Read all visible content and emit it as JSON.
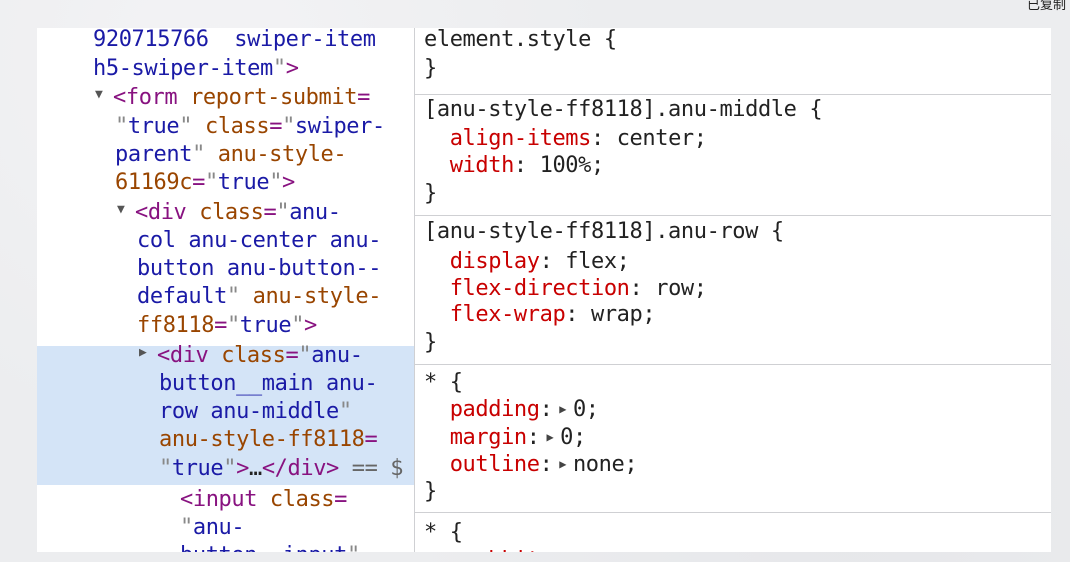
{
  "elements": {
    "lines": [
      {
        "parts": [
          {
            "c": "val",
            "t": "920715766  swiper-item"
          }
        ]
      },
      {
        "parts": [
          {
            "c": "val",
            "t": "h5-swiper-item"
          },
          {
            "c": "qt",
            "t": "\""
          },
          {
            "c": "tag",
            "t": ">"
          }
        ]
      },
      {
        "tri": "▼",
        "parts": [
          {
            "c": "tag",
            "t": "<form "
          },
          {
            "c": "attr",
            "t": "report-submit"
          },
          {
            "c": "tag",
            "t": "="
          }
        ]
      },
      {
        "parts": [
          {
            "c": "qt",
            "t": "\""
          },
          {
            "c": "val",
            "t": "true"
          },
          {
            "c": "qt",
            "t": "\""
          },
          {
            "c": "txt",
            "t": " "
          },
          {
            "c": "attr",
            "t": "class"
          },
          {
            "c": "tag",
            "t": "="
          },
          {
            "c": "qt",
            "t": "\""
          },
          {
            "c": "val",
            "t": "swiper-"
          }
        ]
      },
      {
        "parts": [
          {
            "c": "val",
            "t": "parent"
          },
          {
            "c": "qt",
            "t": "\""
          },
          {
            "c": "txt",
            "t": " "
          },
          {
            "c": "attr",
            "t": "anu-style-"
          }
        ]
      },
      {
        "parts": [
          {
            "c": "attr",
            "t": "61169c"
          },
          {
            "c": "tag",
            "t": "="
          },
          {
            "c": "qt",
            "t": "\""
          },
          {
            "c": "val",
            "t": "true"
          },
          {
            "c": "qt",
            "t": "\""
          },
          {
            "c": "tag",
            "t": ">"
          }
        ]
      },
      {
        "tri": "▼",
        "parts": [
          {
            "c": "tag",
            "t": "<div "
          },
          {
            "c": "attr",
            "t": "class"
          },
          {
            "c": "tag",
            "t": "="
          },
          {
            "c": "qt",
            "t": "\""
          },
          {
            "c": "val",
            "t": "anu-"
          }
        ]
      },
      {
        "parts": [
          {
            "c": "val",
            "t": "col anu-center anu-"
          }
        ]
      },
      {
        "parts": [
          {
            "c": "val",
            "t": "button anu-button--"
          }
        ]
      },
      {
        "parts": [
          {
            "c": "val",
            "t": "default"
          },
          {
            "c": "qt",
            "t": "\""
          },
          {
            "c": "txt",
            "t": " "
          },
          {
            "c": "attr",
            "t": "anu-style-"
          }
        ]
      },
      {
        "parts": [
          {
            "c": "attr",
            "t": "ff8118"
          },
          {
            "c": "tag",
            "t": "="
          },
          {
            "c": "qt",
            "t": "\""
          },
          {
            "c": "val",
            "t": "true"
          },
          {
            "c": "qt",
            "t": "\""
          },
          {
            "c": "tag",
            "t": ">"
          }
        ]
      },
      {
        "tri": "▶",
        "parts": [
          {
            "c": "tag",
            "t": "<div "
          },
          {
            "c": "attr",
            "t": "class"
          },
          {
            "c": "tag",
            "t": "="
          },
          {
            "c": "qt",
            "t": "\""
          },
          {
            "c": "val",
            "t": "anu-"
          }
        ]
      },
      {
        "parts": [
          {
            "c": "val",
            "t": "button__main anu-"
          }
        ]
      },
      {
        "parts": [
          {
            "c": "val",
            "t": "row anu-middle"
          },
          {
            "c": "qt",
            "t": "\""
          }
        ]
      },
      {
        "parts": [
          {
            "c": "attr",
            "t": "anu-style-ff8118"
          },
          {
            "c": "tag",
            "t": "="
          }
        ]
      },
      {
        "parts": [
          {
            "c": "qt",
            "t": "\""
          },
          {
            "c": "val",
            "t": "true"
          },
          {
            "c": "qt",
            "t": "\""
          },
          {
            "c": "tag",
            "t": ">"
          },
          {
            "c": "txt",
            "t": "…"
          },
          {
            "c": "tag",
            "t": "</div>"
          },
          {
            "c": "dim",
            "t": " == $"
          }
        ]
      },
      {
        "parts": [
          {
            "c": "tag",
            "t": "<input "
          },
          {
            "c": "attr",
            "t": "class"
          },
          {
            "c": "tag",
            "t": "="
          }
        ]
      },
      {
        "parts": [
          {
            "c": "qt",
            "t": "\""
          },
          {
            "c": "val",
            "t": "anu-"
          }
        ]
      },
      {
        "parts": [
          {
            "c": "val",
            "t": "button__input"
          },
          {
            "c": "qt",
            "t": "\""
          }
        ]
      }
    ]
  },
  "styles": {
    "lines": [
      {
        "parts": [
          {
            "c": "sel",
            "t": "element.style "
          },
          {
            "c": "brace",
            "t": "{"
          }
        ]
      },
      {
        "parts": [
          {
            "c": "brace",
            "t": "}"
          }
        ]
      },
      {
        "parts": [
          {
            "c": "sel",
            "t": "[anu-style-ff8118].anu-middle "
          },
          {
            "c": "brace",
            "t": "{"
          }
        ]
      },
      {
        "parts": [
          {
            "c": "prop",
            "t": "  align-items"
          },
          {
            "c": "pval",
            "t": ": center;"
          }
        ]
      },
      {
        "parts": [
          {
            "c": "prop",
            "t": "  width"
          },
          {
            "c": "pval",
            "t": ": 100%;"
          }
        ]
      },
      {
        "parts": [
          {
            "c": "brace",
            "t": "}"
          }
        ]
      },
      {
        "parts": [
          {
            "c": "sel",
            "t": "[anu-style-ff8118].anu-row "
          },
          {
            "c": "brace",
            "t": "{"
          }
        ]
      },
      {
        "parts": [
          {
            "c": "prop",
            "t": "  display"
          },
          {
            "c": "pval",
            "t": ": flex;"
          }
        ]
      },
      {
        "parts": [
          {
            "c": "prop",
            "t": "  flex-direction"
          },
          {
            "c": "pval",
            "t": ": row;"
          }
        ]
      },
      {
        "parts": [
          {
            "c": "prop",
            "t": "  flex-wrap"
          },
          {
            "c": "pval",
            "t": ": wrap;"
          }
        ]
      },
      {
        "parts": [
          {
            "c": "brace",
            "t": "}"
          }
        ]
      },
      {
        "parts": [
          {
            "c": "sel",
            "t": "* "
          },
          {
            "c": "brace",
            "t": "{"
          }
        ]
      },
      {
        "parts": [
          {
            "c": "prop",
            "t": "  padding"
          },
          {
            "c": "pval",
            "t": ":"
          },
          {
            "c": "arrow",
            "t": " ▶ "
          },
          {
            "c": "pval",
            "t": "0;"
          }
        ]
      },
      {
        "parts": [
          {
            "c": "prop",
            "t": "  margin"
          },
          {
            "c": "pval",
            "t": ":"
          },
          {
            "c": "arrow",
            "t": " ▶ "
          },
          {
            "c": "pval",
            "t": "0;"
          }
        ]
      },
      {
        "parts": [
          {
            "c": "prop",
            "t": "  outline"
          },
          {
            "c": "pval",
            "t": ":"
          },
          {
            "c": "arrow",
            "t": " ▶ "
          },
          {
            "c": "pval",
            "t": "none;"
          }
        ]
      },
      {
        "parts": [
          {
            "c": "brace",
            "t": "}"
          }
        ]
      },
      {
        "parts": [
          {
            "c": "sel",
            "t": "* "
          },
          {
            "c": "brace",
            "t": "{"
          }
        ]
      },
      {
        "parts": [
          {
            "c": "prop",
            "t": "  -webkit-"
          }
        ]
      }
    ]
  },
  "corner_text": "已复制"
}
